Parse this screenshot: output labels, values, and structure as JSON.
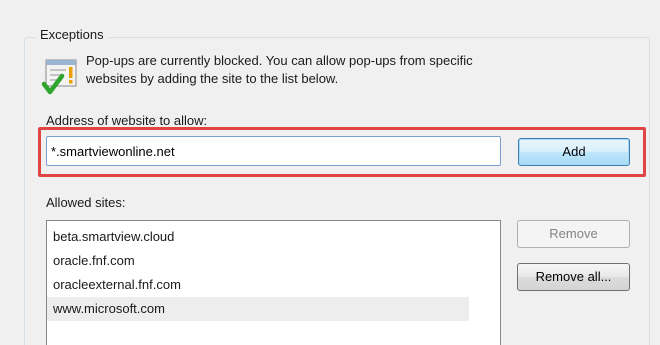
{
  "exceptions": {
    "group_title": "Exceptions",
    "info_text_line1": "Pop-ups are currently blocked.  You can allow pop-ups from specific",
    "info_text_line2": "websites by adding the site to the list below.",
    "info_icon": "popup-blocked-check-icon",
    "address_label": "Address of website to allow:",
    "address_value": "*.smartviewonline.net",
    "add_label": "Add",
    "allowed_sites_label": "Allowed sites:",
    "allowed_sites": [
      "beta.smartview.cloud",
      "oracle.fnf.com",
      "oracleexternal.fnf.com",
      "www.microsoft.com"
    ],
    "selected_site": "www.microsoft.com",
    "remove_label": "Remove",
    "remove_all_label": "Remove all...",
    "highlight_color": "#e04545"
  }
}
